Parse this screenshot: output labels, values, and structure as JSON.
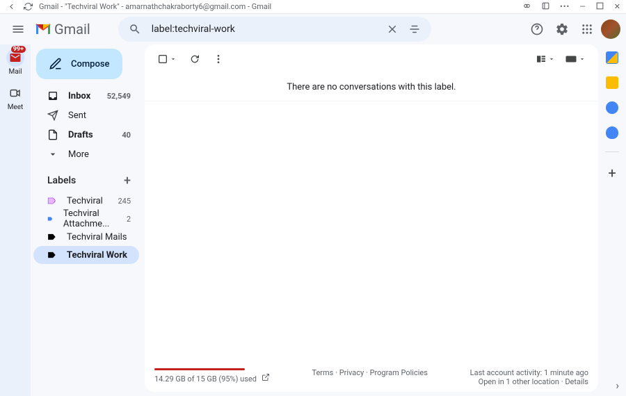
{
  "window": {
    "title": "Gmail - \"Techviral Work\" - amarnathchakraborty6@gmail.com - Gmail"
  },
  "header": {
    "logo_text": "Gmail",
    "search_value": "label:techviral-work"
  },
  "leftrail": {
    "mail": "Mail",
    "meet": "Meet",
    "badge": "99+"
  },
  "compose_label": "Compose",
  "nav": {
    "inbox": {
      "label": "Inbox",
      "count": "52,549"
    },
    "sent": {
      "label": "Sent"
    },
    "drafts": {
      "label": "Drafts",
      "count": "40"
    },
    "more": {
      "label": "More"
    }
  },
  "labels_header": "Labels",
  "labels": [
    {
      "name": "Techviral",
      "count": "245",
      "color": "#e8b5ff"
    },
    {
      "name": "Techviral Attachme...",
      "count": "2",
      "color": "#4285f4"
    },
    {
      "name": "Techviral Mails",
      "color": "#000000"
    },
    {
      "name": "Techviral Work",
      "color": "#000000"
    }
  ],
  "empty_message": "There are no conversations with this label.",
  "footer": {
    "storage": "14.29 GB of 15 GB (95%) used",
    "terms": "Terms",
    "privacy": "Privacy",
    "policies": "Program Policies",
    "activity": "Last account activity: 1 minute ago",
    "locations": "Open in 1 other location",
    "details": "Details"
  }
}
